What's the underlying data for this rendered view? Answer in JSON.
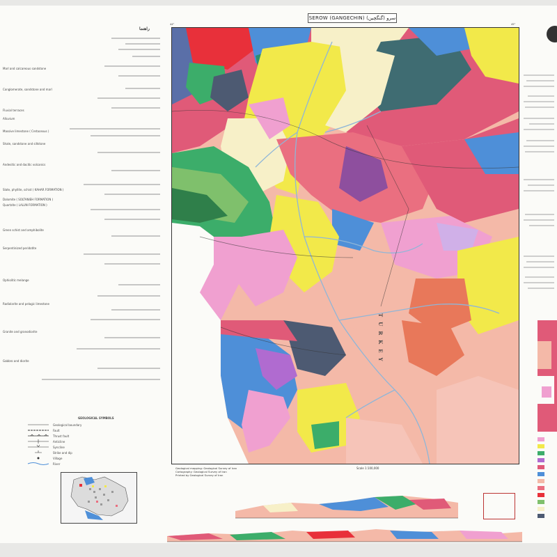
{
  "map": {
    "title": "SEROW (GANGECHIN) سرو (گنگچین)",
    "country_label": "TURKEY",
    "legend_heading": "راهنما",
    "legend_notes": [
      "Marl and calcareous sandstone",
      "Conglomerate, sandstone and marl",
      "Fluvial terraces",
      "Alluvium",
      "Massive limestone ( Cretaceous )",
      "Shale, sandstone and siltstone",
      "Andesitic and dacitic volcanics",
      "Slate, phyllite, schist ( KAHAR FORMATION )",
      "Dolomite ( SOLTANIEH FORMATION )",
      "Quartzite ( LALUN FORMATION )",
      "Green schist and amphibolite",
      "Serpentinized peridotite",
      "Ophiolitic melange",
      "Radiolarite and pelagic limestone",
      "Granite and granodiorite",
      "Gabbro and diorite"
    ],
    "symbols_heading": "GEOLOGICAL SYMBOLS",
    "symbols": [
      "Geological boundary",
      "Fault",
      "Thrust fault",
      "Anticline",
      "Syncline",
      "Strike and dip",
      "Village",
      "River"
    ],
    "scale": "Scale 1:100,000",
    "credits": [
      "Geological mapping: Geological Survey of Iran",
      "Cartography: Geological Survey of Iran",
      "Printed by Geological Survey of Iran"
    ],
    "colors": {
      "alluvium": "#f7f0c8",
      "limestone": "#e05a78",
      "volcanic": "#f0a0d0",
      "yellow": "#f2e94a",
      "blue": "#4e8fd8",
      "green": "#3cad6a",
      "dark": "#4d5a72",
      "salmon": "#f4b9a8",
      "red": "#e8303a",
      "rose": "#ea6f80"
    }
  }
}
